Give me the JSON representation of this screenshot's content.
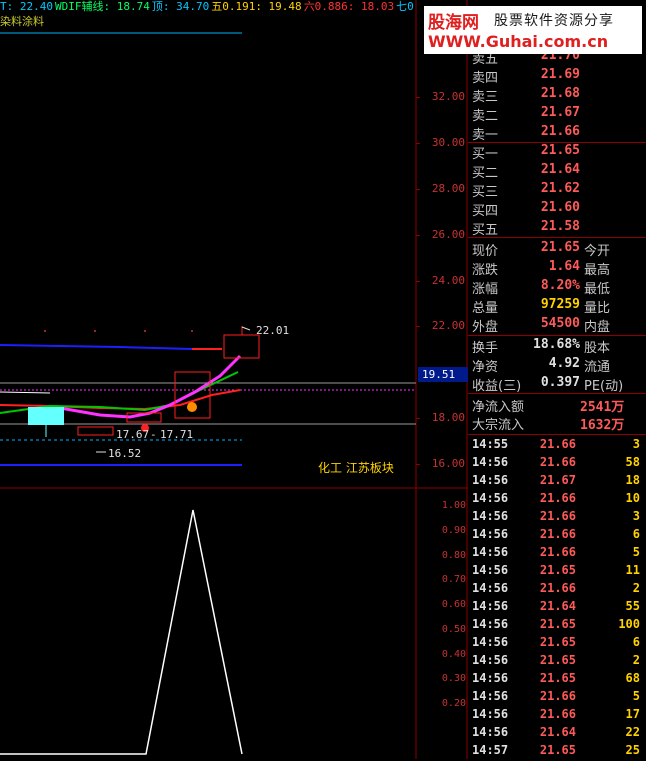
{
  "indicator_bar": [
    {
      "text": "T: 22.40",
      "color": "#00c8ff"
    },
    {
      "text": "WDIF辅线: 18.74",
      "color": "#00ff64"
    },
    {
      "text": "顶: 34.70",
      "color": "#00c8ff"
    },
    {
      "text": "五0.191: 19.48",
      "color": "#ffd200"
    },
    {
      "text": "六0.886: 18.03",
      "color": "#ff3232"
    },
    {
      "text": "七0",
      "color": "#00c8ff"
    }
  ],
  "sector_name": "染料涂料",
  "logo": {
    "cn": "股海网",
    "slogan": "股票软件资源分享",
    "url": "WWW.Guhai.com.cn"
  },
  "price_axis": [
    {
      "label": "32.00",
      "value": 32
    },
    {
      "label": "30.00",
      "value": 30
    },
    {
      "label": "28.00",
      "value": 28
    },
    {
      "label": "26.00",
      "value": 26
    },
    {
      "label": "24.00",
      "value": 24
    },
    {
      "label": "22.00",
      "value": 22
    },
    {
      "label": "18.00",
      "value": 18
    },
    {
      "label": "16.00",
      "value": 16
    }
  ],
  "osc_axis": [
    "1.00",
    "0.90",
    "0.80",
    "0.70",
    "0.60",
    "0.50",
    "0.40",
    "0.30",
    "0.20"
  ],
  "current_price_tag": "19.51",
  "sector_tag": "化工 江苏板块",
  "annotations": {
    "high": "22.01",
    "low1": "17.67",
    "low2": "17.71",
    "low3": "16.52"
  },
  "orderbook": {
    "asks": [
      {
        "label": "卖五",
        "price": "21.70"
      },
      {
        "label": "卖四",
        "price": "21.69"
      },
      {
        "label": "卖三",
        "price": "21.68"
      },
      {
        "label": "卖二",
        "price": "21.67"
      },
      {
        "label": "卖一",
        "price": "21.66"
      }
    ],
    "bids": [
      {
        "label": "买一",
        "price": "21.65"
      },
      {
        "label": "买二",
        "price": "21.64"
      },
      {
        "label": "买三",
        "price": "21.62"
      },
      {
        "label": "买四",
        "price": "21.60"
      },
      {
        "label": "买五",
        "price": "21.58"
      }
    ]
  },
  "stats": [
    {
      "l1": "现价",
      "v1": "21.65",
      "c1": "#ff5a5a",
      "l2": "今开"
    },
    {
      "l1": "涨跌",
      "v1": "1.64",
      "c1": "#ff5a5a",
      "l2": "最高"
    },
    {
      "l1": "涨幅",
      "v1": "8.20%",
      "c1": "#ff5a5a",
      "l2": "最低"
    },
    {
      "l1": "总量",
      "v1": "97259",
      "c1": "#ffd200",
      "l2": "量比"
    },
    {
      "l1": "外盘",
      "v1": "54500",
      "c1": "#ff5a5a",
      "l2": "内盘"
    }
  ],
  "stats2": [
    {
      "l1": "换手",
      "v1": "18.68%",
      "c1": "#e0e0e0",
      "l2": "股本"
    },
    {
      "l1": "净资",
      "v1": "4.92",
      "c1": "#e0e0e0",
      "l2": "流通"
    },
    {
      "l1": "收益(三)",
      "v1": "0.397",
      "c1": "#e0e0e0",
      "l2": "PE(动)"
    }
  ],
  "flows": [
    {
      "label": "净流入额",
      "value": "2541万"
    },
    {
      "label": "大宗流入",
      "value": "1632万"
    }
  ],
  "ticks": [
    {
      "time": "14:55",
      "price": "21.66",
      "vol": "3",
      "color": "#ff5a5a"
    },
    {
      "time": "14:56",
      "price": "21.66",
      "vol": "58",
      "color": "#ff5a5a"
    },
    {
      "time": "14:56",
      "price": "21.67",
      "vol": "18",
      "color": "#ff5a5a"
    },
    {
      "time": "14:56",
      "price": "21.66",
      "vol": "10",
      "color": "#ff5a5a"
    },
    {
      "time": "14:56",
      "price": "21.66",
      "vol": "3",
      "color": "#ff5a5a"
    },
    {
      "time": "14:56",
      "price": "21.66",
      "vol": "6",
      "color": "#ff5a5a"
    },
    {
      "time": "14:56",
      "price": "21.66",
      "vol": "5",
      "color": "#ff5a5a"
    },
    {
      "time": "14:56",
      "price": "21.65",
      "vol": "11",
      "color": "#ff5a5a"
    },
    {
      "time": "14:56",
      "price": "21.66",
      "vol": "2",
      "color": "#ff5a5a"
    },
    {
      "time": "14:56",
      "price": "21.64",
      "vol": "55",
      "color": "#ff5a5a"
    },
    {
      "time": "14:56",
      "price": "21.65",
      "vol": "100",
      "color": "#ff5a5a"
    },
    {
      "time": "14:56",
      "price": "21.65",
      "vol": "6",
      "color": "#ff5a5a"
    },
    {
      "time": "14:56",
      "price": "21.65",
      "vol": "2",
      "color": "#ff5a5a"
    },
    {
      "time": "14:56",
      "price": "21.65",
      "vol": "68",
      "color": "#ff5a5a"
    },
    {
      "time": "14:56",
      "price": "21.66",
      "vol": "5",
      "color": "#ff5a5a"
    },
    {
      "time": "14:56",
      "price": "21.66",
      "vol": "17",
      "color": "#ff5a5a"
    },
    {
      "time": "14:56",
      "price": "21.64",
      "vol": "22",
      "color": "#ff5a5a"
    },
    {
      "time": "14:57",
      "price": "21.65",
      "vol": "25",
      "color": "#ff5a5a"
    }
  ],
  "colors": {
    "grid": "#8c0000",
    "ma_blue": "#1e1eff",
    "ma_magenta": "#ff32ff",
    "ma_green": "#00c800",
    "ma_red": "#ff2020",
    "cyan_box": "#64ffff"
  }
}
